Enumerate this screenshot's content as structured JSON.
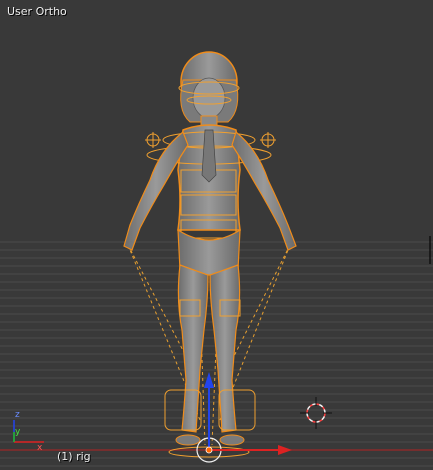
{
  "viewport": {
    "view_label": "User Ortho",
    "object_label": "(1) rig",
    "active_object": "rig"
  },
  "axis_gizmo": {
    "x_label": "x",
    "y_label": "y",
    "z_label": "z"
  },
  "colors": {
    "background": "#393939",
    "grid_line": "#4a4a4a",
    "selection_outline": "#f08c1a",
    "mesh": "#8a8a8a",
    "x_axis": "#dd2222",
    "y_axis": "#22bb22",
    "z_axis": "#2244ee"
  },
  "icons": [
    "3d-cursor-icon",
    "manipulator-icon",
    "axis-gizmo-icon"
  ]
}
